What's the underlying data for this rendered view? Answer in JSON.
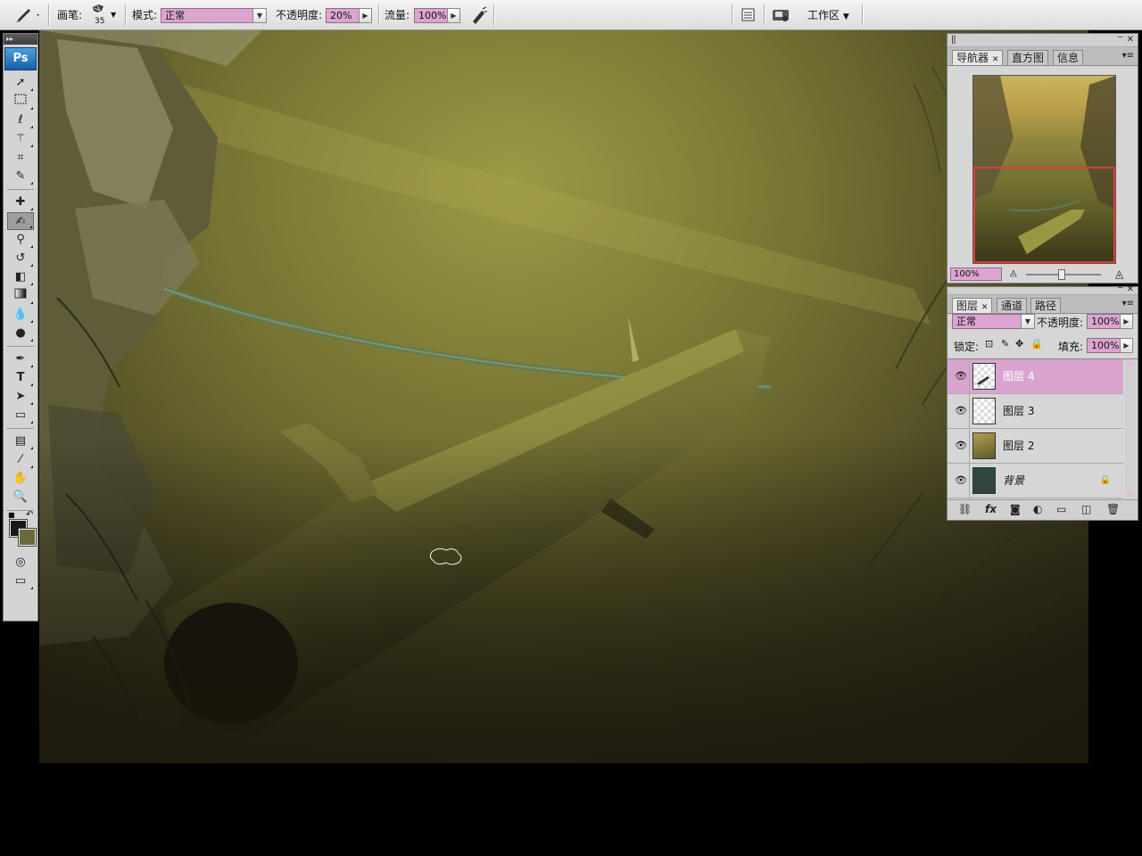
{
  "options_bar": {
    "brush_label": "画笔:",
    "brush_size": "35",
    "mode_label": "模式:",
    "mode_value": "正常",
    "opacity_label": "不透明度:",
    "opacity_value": "20%",
    "flow_label": "流量:",
    "flow_value": "100%",
    "workspace_label": "工作区"
  },
  "toolbox": {
    "logo": "Ps",
    "tools": [
      "move",
      "marquee",
      "lasso",
      "magic-wand",
      "crop",
      "slice",
      "healing",
      "brush",
      "clone-stamp",
      "history-brush",
      "eraser",
      "gradient",
      "blur",
      "dodge",
      "pen",
      "type",
      "path-selection",
      "shape",
      "notes",
      "eyedropper",
      "hand",
      "zoom"
    ],
    "active_tool": "brush",
    "foreground_color": "#1a1a14",
    "background_color": "#6a6a3a"
  },
  "navigator_panel": {
    "tabs": [
      {
        "label": "导航器",
        "active": true
      },
      {
        "label": "直方图",
        "active": false
      },
      {
        "label": "信息",
        "active": false
      }
    ],
    "zoom_value": "100%"
  },
  "layers_panel": {
    "tabs": [
      {
        "label": "图层",
        "active": true
      },
      {
        "label": "通道",
        "active": false
      },
      {
        "label": "路径",
        "active": false
      }
    ],
    "blend_mode": "正常",
    "opacity_label": "不透明度:",
    "opacity_value": "100%",
    "lock_label": "锁定:",
    "fill_label": "填充:",
    "fill_value": "100%",
    "layers": [
      {
        "name": "图层 4",
        "selected": true,
        "visible": true
      },
      {
        "name": "图层 3",
        "selected": false,
        "visible": true
      },
      {
        "name": "图层 2",
        "selected": false,
        "visible": true
      },
      {
        "name": "背景",
        "selected": false,
        "visible": true,
        "locked": true
      }
    ]
  },
  "colors": {
    "selection_pink": "#dba5cf",
    "navigator_frame": "#e23a3a"
  }
}
